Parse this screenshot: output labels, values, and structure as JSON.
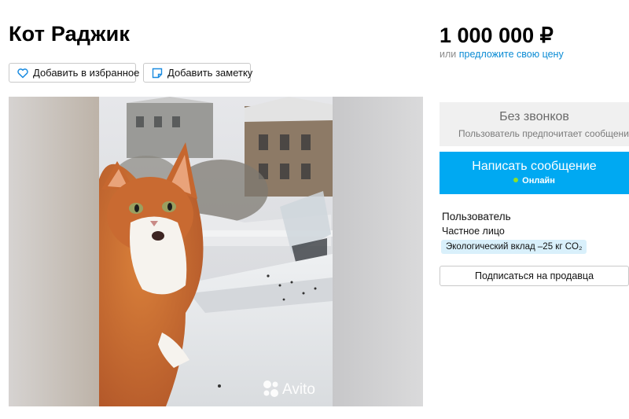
{
  "listing": {
    "title": "Кот Раджик",
    "favorite_label": "Добавить в избранное",
    "note_label": "Добавить заметку"
  },
  "price": {
    "amount": "1 000 000 ₽",
    "or_label": "или",
    "offer_link": "предложите свою цену"
  },
  "gallery": {
    "watermark": "Avito",
    "photo_icon": "avito-logo-icon"
  },
  "contact": {
    "no_calls_title": "Без звонков",
    "no_calls_subtitle": "Пользователь предпочитает сообщения",
    "write_label": "Написать сообщение",
    "online_label": "Онлайн",
    "online_color": "#8de02b",
    "button_color": "#00a9f2"
  },
  "seller": {
    "name": "Пользователь",
    "type": "Частное лицо",
    "eco_badge": "Экологический вклад –25 кг CO₂",
    "subscribe_label": "Подписаться на продавца"
  }
}
